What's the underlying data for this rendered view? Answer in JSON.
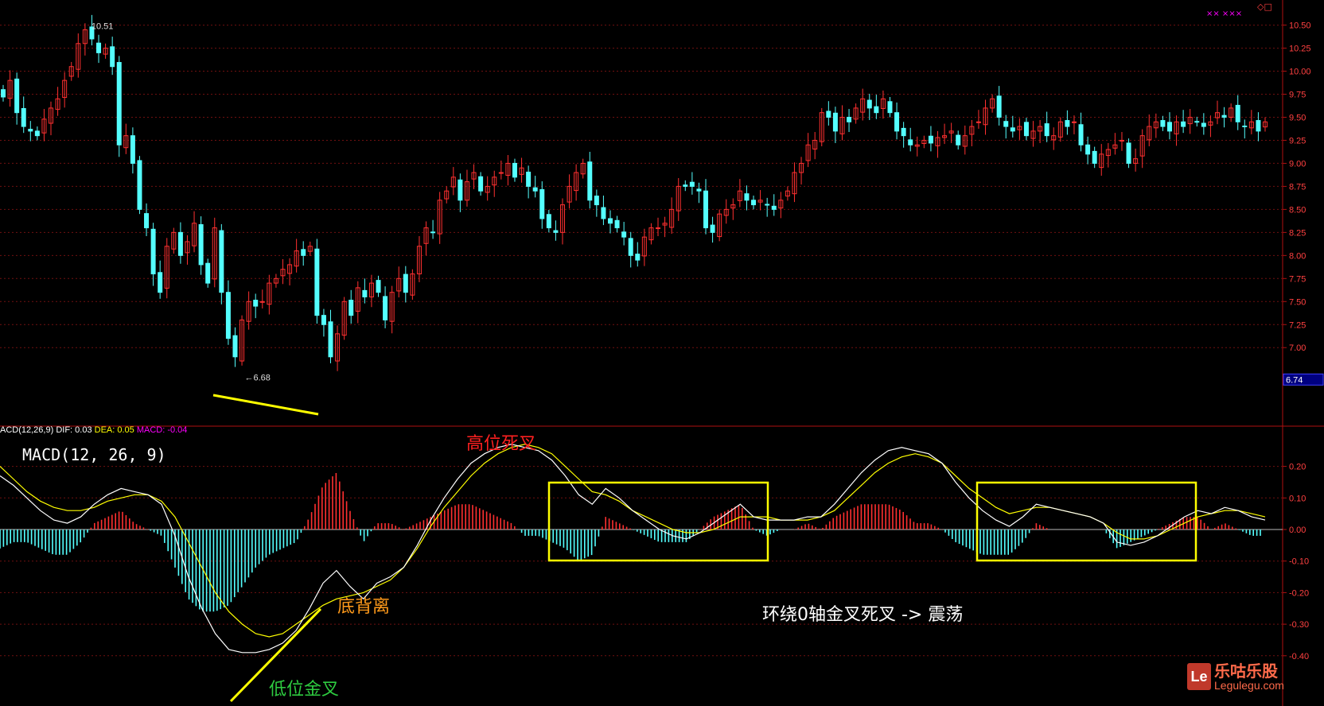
{
  "colors": {
    "up": "#ff3030",
    "down": "#54ffff",
    "dif": "#ffffff",
    "dea": "#ffff00",
    "axis": "#b01010",
    "annotation_box": "#ffff00",
    "divergence_line": "#ffff00"
  },
  "labels": {
    "high_price": "10.51",
    "low_price": "6.68",
    "last_price": "6.74",
    "macd_header_name": "ACD(12,26,9)",
    "dif_text": "DIF: 0.03",
    "dea_text": "DEA: 0.05",
    "macd_text": "MACD: -0.04",
    "macd_title": "MACD(12, 26, 9)",
    "ann_high_dead_cross": "高位死叉",
    "ann_bottom_divergence": "底背离",
    "ann_low_golden_cross": "低位金叉",
    "ann_oscillation": "环绕0轴金叉死叉 -> 震荡",
    "top_icons": "×× ×××",
    "top_right_icon": "◇□",
    "watermark_cn": "乐咕乐股",
    "watermark_url": "Legulegu.com",
    "watermark_logo": "Le"
  },
  "chart_data": [
    {
      "type": "candlestick",
      "ylim": [
        6.7,
        10.6
      ],
      "yticks": [
        "10.50",
        "10.25",
        "10.00",
        "9.75",
        "9.50",
        "9.25",
        "9.00",
        "8.75",
        "8.50",
        "8.25",
        "8.00",
        "7.75",
        "7.50",
        "7.25",
        "7.00"
      ],
      "close": [
        9.72,
        9.9,
        9.55,
        9.4,
        9.35,
        9.3,
        9.48,
        9.6,
        9.7,
        9.9,
        10.05,
        10.3,
        10.45,
        10.35,
        10.2,
        10.25,
        10.05,
        9.2,
        9.3,
        9.0,
        8.5,
        8.3,
        7.8,
        7.6,
        8.1,
        8.25,
        8.0,
        8.15,
        8.35,
        7.9,
        7.7,
        8.3,
        7.6,
        7.1,
        6.9,
        7.3,
        7.5,
        7.45,
        7.5,
        7.7,
        7.75,
        7.85,
        7.9,
        8.05,
        8.0,
        8.1,
        7.35,
        7.25,
        6.9,
        7.15,
        7.5,
        7.35,
        7.65,
        7.55,
        7.7,
        7.6,
        7.3,
        7.6,
        7.75,
        7.6,
        7.8,
        8.1,
        8.3,
        8.25,
        8.6,
        8.7,
        8.85,
        8.6,
        8.8,
        8.9,
        8.7,
        8.75,
        8.85,
        8.9,
        9.0,
        8.85,
        8.95,
        8.75,
        8.7,
        8.4,
        8.3,
        8.25,
        8.55,
        8.75,
        8.9,
        9.0,
        8.6,
        8.55,
        8.4,
        8.35,
        8.3,
        8.2,
        8.0,
        7.95,
        8.2,
        8.3,
        8.3,
        8.35,
        8.5,
        8.75,
        8.75,
        8.75,
        8.7,
        8.3,
        8.25,
        8.45,
        8.5,
        8.55,
        8.7,
        8.6,
        8.55,
        8.6,
        8.55,
        8.5,
        8.6,
        8.7,
        8.9,
        9.0,
        9.2,
        9.25,
        9.55,
        9.5,
        9.35,
        9.5,
        9.45,
        9.6,
        9.7,
        9.6,
        9.55,
        9.7,
        9.55,
        9.35,
        9.3,
        9.2,
        9.2,
        9.25,
        9.22,
        9.28,
        9.3,
        9.35,
        9.2,
        9.3,
        9.4,
        9.45,
        9.6,
        9.7,
        9.5,
        9.4,
        9.35,
        9.4,
        9.3,
        9.35,
        9.4,
        9.3,
        9.3,
        9.45,
        9.4,
        9.45,
        9.2,
        9.1,
        9.0,
        9.1,
        9.15,
        9.2,
        9.25,
        9.0,
        9.05,
        9.3,
        9.4,
        9.45,
        9.4,
        9.35,
        9.45,
        9.4,
        9.5,
        9.45,
        9.4,
        9.45,
        9.55,
        9.5,
        9.6,
        9.45,
        9.4,
        9.45,
        9.35,
        9.45
      ]
    },
    {
      "type": "macd",
      "params": "12,26,9",
      "ylim": [
        -0.42,
        0.3
      ],
      "yticks": [
        "0.20",
        "0.10",
        "0.00",
        "-0.10",
        "-0.20",
        "-0.30",
        "-0.40"
      ],
      "dif": [
        0.17,
        0.14,
        0.1,
        0.06,
        0.03,
        0.02,
        0.04,
        0.08,
        0.11,
        0.13,
        0.12,
        0.11,
        0.08,
        -0.02,
        -0.15,
        -0.25,
        -0.33,
        -0.38,
        -0.39,
        -0.39,
        -0.38,
        -0.36,
        -0.32,
        -0.25,
        -0.17,
        -0.13,
        -0.18,
        -0.22,
        -0.17,
        -0.15,
        -0.12,
        -0.05,
        0.03,
        0.1,
        0.16,
        0.21,
        0.24,
        0.26,
        0.27,
        0.26,
        0.25,
        0.22,
        0.17,
        0.11,
        0.08,
        0.13,
        0.1,
        0.06,
        0.03,
        0.0,
        -0.02,
        -0.03,
        -0.01,
        0.02,
        0.05,
        0.08,
        0.04,
        0.03,
        0.03,
        0.03,
        0.04,
        0.04,
        0.08,
        0.13,
        0.18,
        0.22,
        0.25,
        0.26,
        0.25,
        0.24,
        0.21,
        0.15,
        0.1,
        0.06,
        0.03,
        0.01,
        0.04,
        0.08,
        0.07,
        0.06,
        0.05,
        0.04,
        0.02,
        -0.04,
        -0.05,
        -0.04,
        -0.02,
        0.01,
        0.04,
        0.06,
        0.05,
        0.07,
        0.06,
        0.04,
        0.03
      ],
      "dea": [
        0.2,
        0.16,
        0.12,
        0.09,
        0.07,
        0.06,
        0.06,
        0.07,
        0.09,
        0.1,
        0.11,
        0.11,
        0.09,
        0.04,
        -0.04,
        -0.12,
        -0.2,
        -0.26,
        -0.3,
        -0.33,
        -0.34,
        -0.33,
        -0.3,
        -0.27,
        -0.24,
        -0.22,
        -0.21,
        -0.2,
        -0.18,
        -0.16,
        -0.12,
        -0.06,
        0.01,
        0.07,
        0.12,
        0.17,
        0.21,
        0.24,
        0.26,
        0.27,
        0.26,
        0.24,
        0.2,
        0.16,
        0.12,
        0.11,
        0.09,
        0.06,
        0.04,
        0.02,
        0.0,
        -0.01,
        -0.01,
        0.0,
        0.02,
        0.04,
        0.04,
        0.04,
        0.03,
        0.03,
        0.03,
        0.04,
        0.06,
        0.1,
        0.14,
        0.18,
        0.21,
        0.23,
        0.24,
        0.23,
        0.21,
        0.17,
        0.13,
        0.1,
        0.07,
        0.05,
        0.06,
        0.07,
        0.07,
        0.06,
        0.05,
        0.04,
        0.02,
        -0.01,
        -0.03,
        -0.03,
        -0.02,
        0.0,
        0.02,
        0.04,
        0.05,
        0.06,
        0.06,
        0.05,
        0.04
      ]
    }
  ]
}
